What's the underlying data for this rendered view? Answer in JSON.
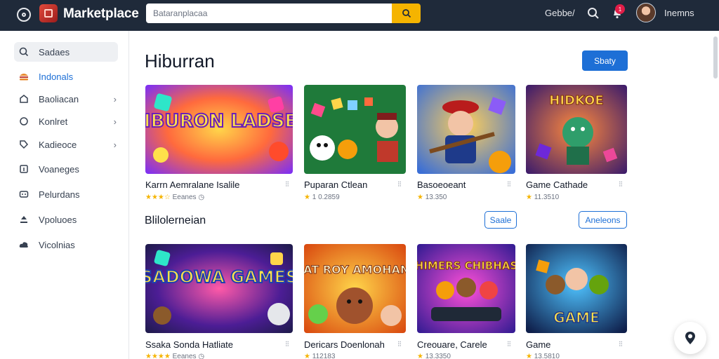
{
  "topbar": {
    "brand": "Marketplace",
    "search_value": "Bataranplacaa",
    "link": "Gebbe/",
    "badge": "1",
    "username": "Inemns"
  },
  "sidebar": {
    "items": [
      {
        "label": "Sadaes",
        "icon": "search-icon",
        "chevron": false
      },
      {
        "label": "Indonals",
        "icon": "burger-icon",
        "chevron": false
      },
      {
        "label": "Baoliacan",
        "icon": "home-icon",
        "chevron": true
      },
      {
        "label": "Konlret",
        "icon": "circle-icon",
        "chevron": true
      },
      {
        "label": "Kadieoce",
        "icon": "tag-icon",
        "chevron": true
      },
      {
        "label": "Voaneges",
        "icon": "info-icon",
        "chevron": false
      },
      {
        "label": "Pelurdans",
        "icon": "gamepad-icon",
        "chevron": false
      },
      {
        "label": "Vpoluoes",
        "icon": "upload-icon",
        "chevron": false
      },
      {
        "label": "Vicolnias",
        "icon": "cloud-icon",
        "chevron": false
      }
    ]
  },
  "main": {
    "title": "Hiburran",
    "primary_button": "Sbaty",
    "section2_title": "Blilolerneian",
    "section2_buttons": [
      "Saale",
      "Aneleons"
    ]
  },
  "cards_row1": [
    {
      "title": "Karrn Aemralane Isalile",
      "rating_text": "Eeanes",
      "stars": 3,
      "thumb_text": "HIBURON LADSEE"
    },
    {
      "title": "Puparan Ctlean",
      "rating_text": "1 0.2859",
      "stars": 1,
      "thumb_text": ""
    },
    {
      "title": "Basoeoeant",
      "rating_text": "13.350",
      "stars": 1,
      "thumb_text": ""
    },
    {
      "title": "Game Cathade",
      "rating_text": "11.3510",
      "stars": 1,
      "thumb_text": "HIDKOE"
    }
  ],
  "cards_row2": [
    {
      "title": "Ssaka Sonda Hatliate",
      "rating_text": "Eeanes",
      "stars": 4,
      "thumb_text": "SADOWA GAMES"
    },
    {
      "title": "Dericars Doenlonah",
      "rating_text": "112183",
      "stars": 1,
      "thumb_text": "FIAT ROY AMOHANS"
    },
    {
      "title": "Creouare, Carele",
      "rating_text": "13.3350",
      "stars": 1,
      "thumb_text": "HIMERS CHIBHAS"
    },
    {
      "title": "Game",
      "rating_text": "13.5810",
      "stars": 1,
      "thumb_text": "GAME"
    }
  ],
  "colors": {
    "topbar": "#1f2a3a",
    "accent": "#1d6fd6",
    "search_button": "#f5b400",
    "star": "#f5b400"
  }
}
